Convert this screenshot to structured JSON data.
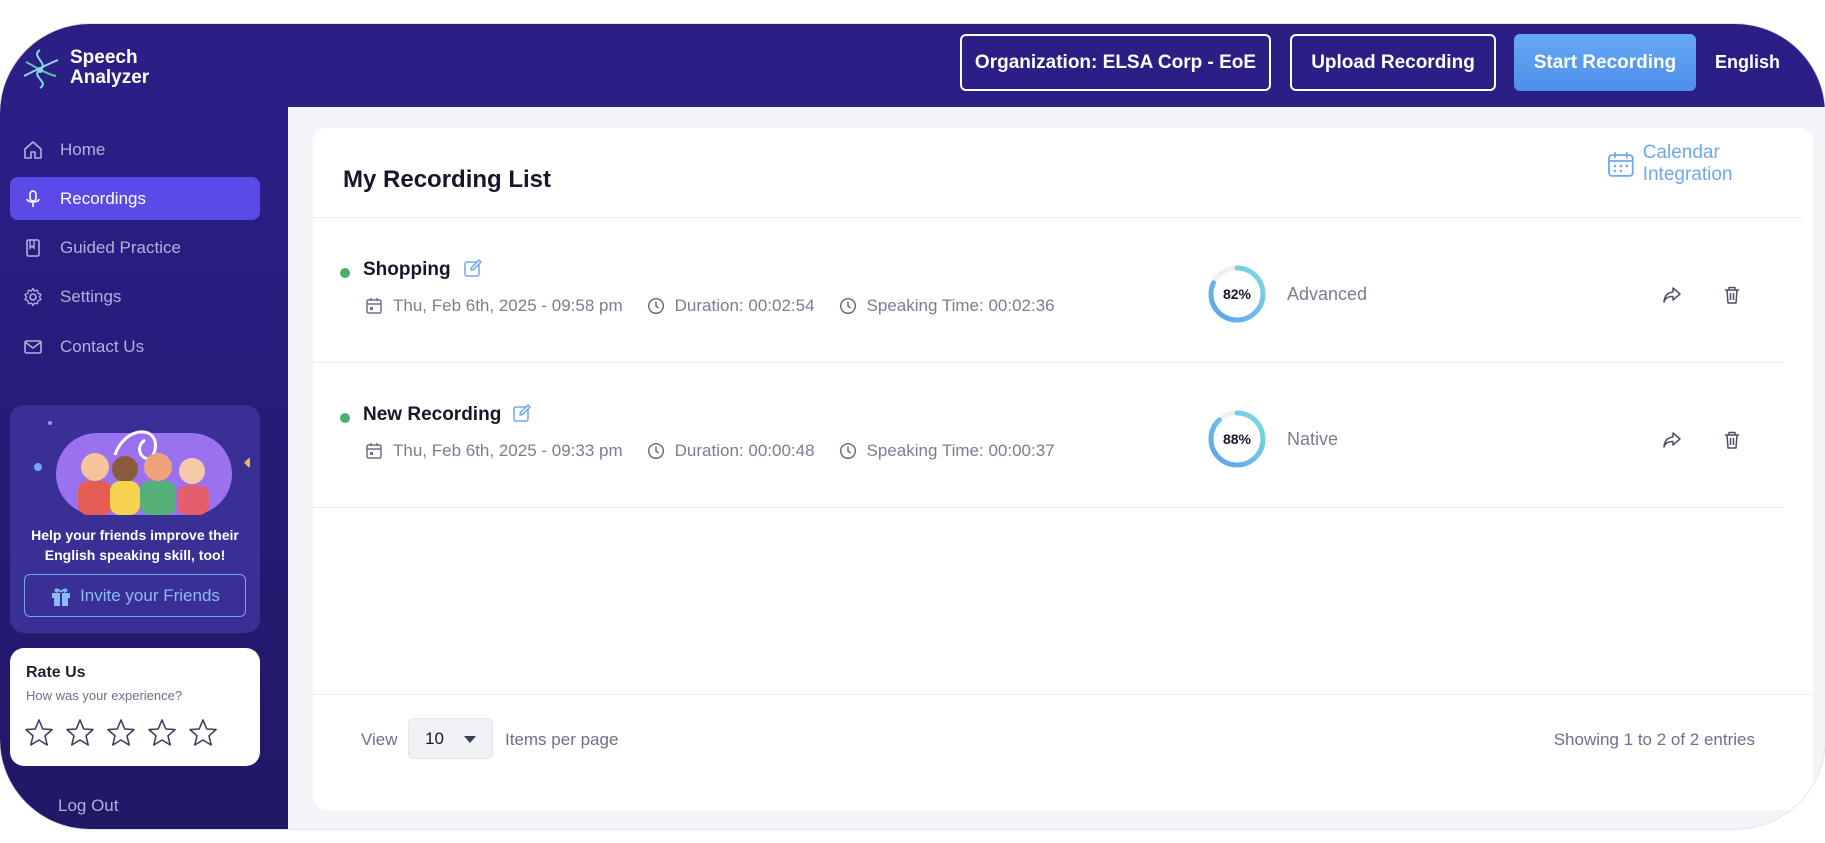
{
  "header": {
    "brand_line1": "Speech",
    "brand_line2": "Analyzer",
    "org_button": "Organization: ELSA Corp - EoE",
    "upload_button": "Upload Recording",
    "start_button": "Start Recording",
    "language": "English"
  },
  "sidebar": {
    "items": [
      {
        "label": "Home",
        "icon": "home-icon",
        "active": false
      },
      {
        "label": "Recordings",
        "icon": "microphone-icon",
        "active": true
      },
      {
        "label": "Guided Practice",
        "icon": "book-icon",
        "active": false
      },
      {
        "label": "Settings",
        "icon": "gear-icon",
        "active": false
      },
      {
        "label": "Contact Us",
        "icon": "mail-icon",
        "active": false
      }
    ],
    "invite_text": "Help your friends improve their English speaking skill, too!",
    "invite_button": "Invite your Friends",
    "rate_title": "Rate Us",
    "rate_subtitle": "How was your experience?",
    "rating_stars": 5,
    "logout": "Log Out"
  },
  "main": {
    "title": "My Recording List",
    "calendar_link": "Calendar Integration",
    "recordings": [
      {
        "name": "Shopping",
        "date": "Thu, Feb 6th, 2025 - 09:58 pm",
        "duration": "Duration: 00:02:54",
        "speaking_time": "Speaking Time: 00:02:36",
        "score": "82%",
        "score_value": 82,
        "level": "Advanced",
        "status_color": "#4caf69"
      },
      {
        "name": "New Recording",
        "date": "Thu, Feb 6th, 2025 - 09:33 pm",
        "duration": "Duration: 00:00:48",
        "speaking_time": "Speaking Time: 00:00:37",
        "score": "88%",
        "score_value": 88,
        "level": "Native",
        "status_color": "#4caf69"
      }
    ],
    "pagination": {
      "view_label": "View",
      "per_page_value": "10",
      "items_per_page_label": "Items per page",
      "showing": "Showing 1 to 2 of 2 entries"
    }
  },
  "colors": {
    "header_bg": "#2b1f86",
    "active_nav": "#5a4be9",
    "accent_blue": "#6ea8f2",
    "ring_gradient_start": "#5aa0ef",
    "ring_gradient_end": "#7fdce0"
  }
}
